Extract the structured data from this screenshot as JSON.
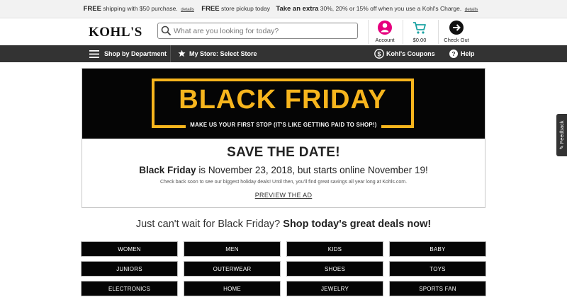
{
  "promo": {
    "free1": "FREE",
    "text1": "shipping with $50 purchase.",
    "details1": "details",
    "free2": "FREE",
    "text2": "store pickup today",
    "extra": "Take an extra",
    "text3": "30%, 20% or 15% off when you use a Kohl's Charge.",
    "details2": "details"
  },
  "header": {
    "logo": "KOHL'S",
    "search_placeholder": "What are you looking for today?",
    "account_label": "Account",
    "cart_label": "$0.00",
    "checkout_label": "Check Out"
  },
  "nav": {
    "shop_by_department": "Shop by Department",
    "my_store": "My Store: Select Store",
    "coupons": "Kohl's Coupons",
    "help": "Help"
  },
  "hero": {
    "title": "BLACK FRIDAY",
    "subtitle": "MAKE US YOUR FIRST STOP (IT'S LIKE GETTING PAID TO SHOP!)",
    "save_the_date": "SAVE THE DATE!",
    "date_bold": "Black Friday",
    "date_rest": "is November 23, 2018, but starts online November 19!",
    "check_back": "Check back soon to see our biggest holiday deals! Until then, you'll find great savings all year long at Kohls.com.",
    "preview_link": "PREVIEW THE AD"
  },
  "tagline": {
    "lead": "Just can't wait for Black Friday?",
    "bold": "Shop today's great deals now!"
  },
  "categories": {
    "women": "WOMEN",
    "men": "MEN",
    "kids": "KIDS",
    "baby": "BABY",
    "juniors": "JUNIORS",
    "outerwear": "OUTERWEAR",
    "shoes": "SHOES",
    "toys": "TOYS",
    "electronics": "ELECTRONICS",
    "home": "HOME",
    "jewelry": "JEWELRY",
    "sports_fan": "SPORTS FAN"
  },
  "feedback": {
    "label": "Feedback"
  },
  "colors": {
    "brand_gold": "#f7b51d",
    "account_magenta": "#e6007e",
    "cart_teal": "#1aa3a3",
    "nav_bg": "#333333"
  }
}
